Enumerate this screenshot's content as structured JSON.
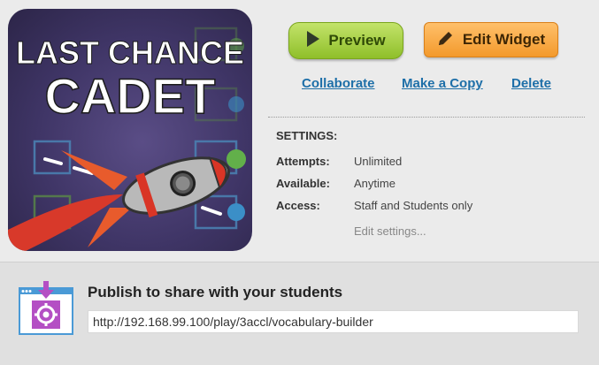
{
  "widget": {
    "art": {
      "title_line1": "LAST CHANCE",
      "title_line2": "CADET"
    }
  },
  "actions": {
    "preview_label": "Preview",
    "edit_label": "Edit Widget",
    "collaborate_label": "Collaborate",
    "copy_label": "Make a Copy",
    "delete_label": "Delete"
  },
  "settings": {
    "title": "SETTINGS:",
    "rows": [
      {
        "label": "Attempts:",
        "value": "Unlimited"
      },
      {
        "label": "Available:",
        "value": "Anytime"
      },
      {
        "label": "Access:",
        "value": "Staff and Students only"
      }
    ],
    "edit_link": "Edit settings..."
  },
  "publish": {
    "title": "Publish to share with your students",
    "url": "http://192.168.99.100/play/3accl/vocabulary-builder"
  },
  "icons": {
    "preview": "play-icon",
    "edit": "pencil-icon",
    "publish": "publish-window-icon"
  },
  "colors": {
    "preview_button": "#9fcb3a",
    "edit_button": "#f7a23c",
    "link": "#1e6fa8",
    "publish_icon": "#b44fc4"
  }
}
